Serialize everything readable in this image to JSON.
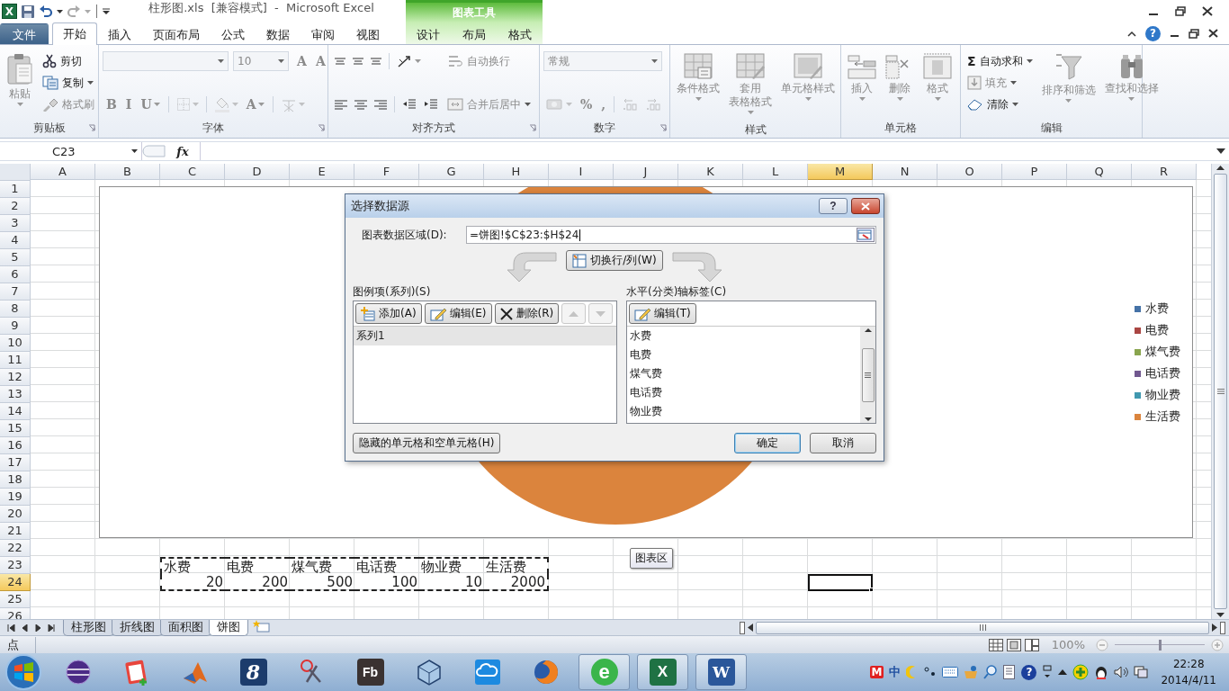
{
  "window": {
    "app_glyph": "X",
    "title": "柱形图.xls  [兼容模式]  -  Microsoft Excel",
    "context_tab_group": "图表工具",
    "help_glyph": "?"
  },
  "ribbon_tabs": [
    {
      "label": "文件",
      "kind": "file",
      "selected": false
    },
    {
      "label": "开始",
      "kind": "main",
      "selected": true
    },
    {
      "label": "插入",
      "kind": "main",
      "selected": false
    },
    {
      "label": "页面布局",
      "kind": "main",
      "selected": false
    },
    {
      "label": "公式",
      "kind": "main",
      "selected": false
    },
    {
      "label": "数据",
      "kind": "main",
      "selected": false
    },
    {
      "label": "审阅",
      "kind": "main",
      "selected": false
    },
    {
      "label": "视图",
      "kind": "main",
      "selected": false
    },
    {
      "label": "设计",
      "kind": "context",
      "selected": false
    },
    {
      "label": "布局",
      "kind": "context",
      "selected": false
    },
    {
      "label": "格式",
      "kind": "context",
      "selected": false
    }
  ],
  "ribbon_groups": [
    {
      "title": "剪贴板",
      "columns": [
        [
          [
            {
              "kind": "large",
              "label": "粘贴",
              "disabled": true,
              "dropdown": true
            }
          ]
        ],
        [
          [
            {
              "kind": "small",
              "label": "剪切",
              "disabled": false,
              "dropdown": false
            }
          ],
          [
            {
              "kind": "small",
              "label": "复制",
              "disabled": false,
              "dropdown": true
            }
          ],
          [
            {
              "kind": "small",
              "label": "格式刷",
              "disabled": true,
              "dropdown": false
            }
          ]
        ]
      ]
    },
    {
      "title": "字体",
      "columns": [
        [
          [
            {
              "kind": "combo",
              "disabled": true
            },
            {
              "kind": "combo",
              "value": "10",
              "disabled": true
            },
            {
              "kind": "text",
              "label": "A",
              "disabled": true,
              "dropdown": false
            },
            {
              "kind": "text",
              "label": "A",
              "disabled": true,
              "dropdown": false
            }
          ],
          [
            {
              "kind": "text",
              "label": "B",
              "disabled": true,
              "dropdown": false
            },
            {
              "kind": "text",
              "label": "I",
              "disabled": true,
              "dropdown": false
            },
            {
              "kind": "text",
              "label": "U",
              "disabled": true,
              "dropdown": true
            },
            {
              "kind": "sep"
            },
            {
              "kind": "icon",
              "disabled": true,
              "dropdown": true
            },
            {
              "kind": "sep"
            },
            {
              "kind": "icon",
              "disabled": true,
              "dropdown": true
            },
            {
              "kind": "text",
              "label": "A",
              "disabled": true,
              "dropdown": true
            },
            {
              "kind": "sep"
            },
            {
              "kind": "icon",
              "disabled": true,
              "dropdown": true
            }
          ]
        ]
      ]
    },
    {
      "title": "对齐方式",
      "columns": [
        [
          [
            {
              "kind": "icon",
              "disabled": false,
              "dropdown": false
            },
            {
              "kind": "icon",
              "disabled": false,
              "dropdown": false
            },
            {
              "kind": "icon",
              "disabled": false,
              "dropdown": false
            },
            {
              "kind": "sep"
            },
            {
              "kind": "icon",
              "disabled": false,
              "dropdown": true
            }
          ],
          [
            {
              "kind": "icon",
              "disabled": false,
              "dropdown": false
            },
            {
              "kind": "icon",
              "disabled": false,
              "dropdown": false
            },
            {
              "kind": "icon",
              "disabled": false,
              "dropdown": false
            },
            {
              "kind": "sep"
            },
            {
              "kind": "icon",
              "disabled": false,
              "dropdown": false
            },
            {
              "kind": "icon",
              "disabled": false,
              "dropdown": false
            }
          ]
        ],
        [
          [
            {
              "kind": "small",
              "label": "自动换行",
              "disabled": true,
              "dropdown": false
            }
          ],
          [
            {
              "kind": "small",
              "label": "合并后居中",
              "disabled": true,
              "dropdown": true
            }
          ]
        ]
      ]
    },
    {
      "title": "数字",
      "columns": [
        [
          [
            {
              "kind": "combo",
              "value": "常规",
              "disabled": true
            }
          ],
          [
            {
              "kind": "icon",
              "disabled": true,
              "dropdown": true
            },
            {
              "kind": "text",
              "label": "%",
              "disabled": true,
              "dropdown": false
            },
            {
              "kind": "text",
              "label": ",",
              "disabled": true,
              "dropdown": false
            },
            {
              "kind": "sep"
            },
            {
              "kind": "icon",
              "disabled": true,
              "dropdown": false
            },
            {
              "kind": "icon",
              "disabled": true,
              "dropdown": false
            }
          ]
        ]
      ]
    },
    {
      "title": "样式",
      "columns": [
        [
          [
            {
              "kind": "large",
              "label": "条件格式",
              "disabled": true,
              "dropdown": true
            }
          ]
        ],
        [
          [
            {
              "kind": "large",
              "label_lines": [
                "套用",
                "表格格式"
              ],
              "disabled": true,
              "dropdown": true
            }
          ]
        ],
        [
          [
            {
              "kind": "large",
              "label": "单元格样式",
              "disabled": true,
              "dropdown": true
            }
          ]
        ]
      ]
    },
    {
      "title": "单元格",
      "columns": [
        [
          [
            {
              "kind": "large",
              "label": "插入",
              "disabled": true,
              "dropdown": true
            }
          ]
        ],
        [
          [
            {
              "kind": "large",
              "label": "删除",
              "disabled": true,
              "dropdown": true
            }
          ]
        ],
        [
          [
            {
              "kind": "large",
              "label": "格式",
              "disabled": true,
              "dropdown": true
            }
          ]
        ]
      ]
    },
    {
      "title": "编辑",
      "columns": [
        [
          [
            {
              "kind": "small",
              "glyph": "Σ",
              "label": "自动求和",
              "disabled": false,
              "dropdown": true
            }
          ],
          [
            {
              "kind": "small",
              "label": "填充",
              "disabled": true,
              "dropdown": true
            }
          ],
          [
            {
              "kind": "small",
              "label": "清除",
              "disabled": false,
              "dropdown": true
            }
          ]
        ],
        [
          [
            {
              "kind": "large",
              "label": "排序和筛选",
              "disabled": true,
              "dropdown": true
            }
          ]
        ],
        [
          [
            {
              "kind": "large",
              "label": "查找和选择",
              "disabled": true,
              "dropdown": true
            }
          ]
        ]
      ]
    }
  ],
  "formula_bar": {
    "name_box": "C23",
    "fx_label": "fx"
  },
  "sheet": {
    "columns": [
      {
        "label": "A",
        "selected": false
      },
      {
        "label": "B",
        "selected": false
      },
      {
        "label": "C",
        "selected": false
      },
      {
        "label": "D",
        "selected": false
      },
      {
        "label": "E",
        "selected": false
      },
      {
        "label": "F",
        "selected": false
      },
      {
        "label": "G",
        "selected": false
      },
      {
        "label": "H",
        "selected": false
      },
      {
        "label": "I",
        "selected": false
      },
      {
        "label": "J",
        "selected": false
      },
      {
        "label": "K",
        "selected": false
      },
      {
        "label": "L",
        "selected": false
      },
      {
        "label": "M",
        "selected": true
      },
      {
        "label": "N",
        "selected": false
      },
      {
        "label": "O",
        "selected": false
      },
      {
        "label": "P",
        "selected": false
      },
      {
        "label": "Q",
        "selected": false
      },
      {
        "label": "R",
        "selected": false
      }
    ],
    "rows": [
      {
        "label": "1",
        "selected": false
      },
      {
        "label": "2",
        "selected": false
      },
      {
        "label": "3",
        "selected": false
      },
      {
        "label": "4",
        "selected": false
      },
      {
        "label": "5",
        "selected": false
      },
      {
        "label": "6",
        "selected": false
      },
      {
        "label": "7",
        "selected": false
      },
      {
        "label": "8",
        "selected": false
      },
      {
        "label": "9",
        "selected": false
      },
      {
        "label": "10",
        "selected": false
      },
      {
        "label": "11",
        "selected": false
      },
      {
        "label": "12",
        "selected": false
      },
      {
        "label": "13",
        "selected": false
      },
      {
        "label": "14",
        "selected": false
      },
      {
        "label": "15",
        "selected": false
      },
      {
        "label": "16",
        "selected": false
      },
      {
        "label": "17",
        "selected": false
      },
      {
        "label": "18",
        "selected": false
      },
      {
        "label": "19",
        "selected": false
      },
      {
        "label": "20",
        "selected": false
      },
      {
        "label": "21",
        "selected": false
      },
      {
        "label": "22",
        "selected": false
      },
      {
        "label": "23",
        "selected": false,
        "cells": [
          null,
          null,
          {
            "text": "水费",
            "kind": "text",
            "in_copy_range": true
          },
          {
            "text": "电费",
            "kind": "text",
            "in_copy_range": true
          },
          {
            "text": "煤气费",
            "kind": "text",
            "in_copy_range": true
          },
          {
            "text": "电话费",
            "kind": "text",
            "in_copy_range": true
          },
          {
            "text": "物业费",
            "kind": "text",
            "in_copy_range": true
          },
          {
            "text": "生活费",
            "kind": "text",
            "in_copy_range": true
          }
        ]
      },
      {
        "label": "24",
        "selected": true,
        "cells": [
          null,
          null,
          {
            "text": "20",
            "kind": "number",
            "in_copy_range": true
          },
          {
            "text": "200",
            "kind": "number",
            "in_copy_range": true
          },
          {
            "text": "500",
            "kind": "number",
            "in_copy_range": true
          },
          {
            "text": "100",
            "kind": "number",
            "in_copy_range": true
          },
          {
            "text": "10",
            "kind": "number",
            "in_copy_range": true
          },
          {
            "text": "2000",
            "kind": "number",
            "in_copy_range": true
          },
          null,
          null,
          null,
          null,
          {
            "kind": "empty",
            "active": true
          }
        ]
      },
      {
        "label": "25",
        "selected": false
      },
      {
        "label": "26",
        "selected": false
      }
    ]
  },
  "chart": {
    "tooltip": "图表区",
    "legend": [
      {
        "label": "水费",
        "color": "#4572a7"
      },
      {
        "label": "电费",
        "color": "#aa4643"
      },
      {
        "label": "煤气费",
        "color": "#89a54e"
      },
      {
        "label": "电话费",
        "color": "#71588f"
      },
      {
        "label": "物业费",
        "color": "#4198af"
      },
      {
        "label": "生活费",
        "color": "#db843d"
      }
    ]
  },
  "dialog": {
    "title": "选择数据源",
    "help_button": "?",
    "range_label": "图表数据区域(D):",
    "range_value": "=饼图!$C$23:$H$24",
    "switch_button": "切换行/列(W)",
    "series_label": "图例项(系列)(S)",
    "series_buttons": [
      {
        "label": "添加(A)",
        "disabled": false
      },
      {
        "label": "编辑(E)",
        "disabled": false
      },
      {
        "label": "删除(R)",
        "disabled": false
      }
    ],
    "move_buttons": [
      {
        "disabled": true
      },
      {
        "disabled": true
      }
    ],
    "series": [
      {
        "label": "系列1",
        "selected": true
      }
    ],
    "axis_label": "水平(分类)轴标签(C)",
    "axis_edit_button": "编辑(T)",
    "categories": [
      "水费",
      "电费",
      "煤气费",
      "电话费",
      "物业费"
    ],
    "hidden_cells_button": "隐藏的单元格和空单元格(H)",
    "ok_button": "确定",
    "cancel_button": "取消"
  },
  "sheet_tabs": [
    {
      "label": "柱形图",
      "selected": false
    },
    {
      "label": "折线图",
      "selected": false
    },
    {
      "label": "面积图",
      "selected": false
    },
    {
      "label": "饼图",
      "selected": true
    }
  ],
  "status_bar": {
    "mode": "点",
    "zoom": "100%",
    "zoom_level": {
      "level": 0.5
    }
  },
  "taskbar": {
    "apps": [
      {
        "open": false
      },
      {
        "open": false
      },
      {
        "open": false
      },
      {
        "open": false,
        "label": "8"
      },
      {
        "open": false
      },
      {
        "open": false,
        "label": "Fb"
      },
      {
        "open": false
      },
      {
        "open": false
      },
      {
        "open": false
      },
      {
        "open": true,
        "label": "e"
      },
      {
        "open": true,
        "label": "X"
      },
      {
        "open": true,
        "label": "W"
      }
    ],
    "tray": {
      "ime_badge": "M",
      "ime_mode": "中",
      "help": "?"
    },
    "time": "22:28",
    "date": "2014/4/11"
  }
}
